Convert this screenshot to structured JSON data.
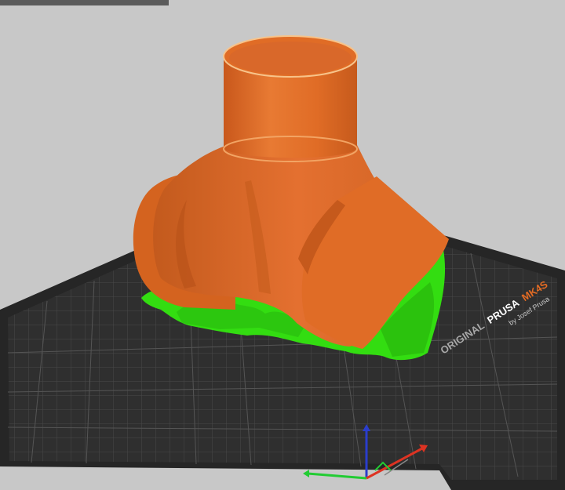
{
  "scene": {
    "bed_brand_prefix": "ORIGINAL",
    "bed_brand": "PRUSA",
    "bed_model": "MK4S",
    "bed_subtitle": "by Josef Prusa",
    "colors": {
      "background": "#c8c8c8",
      "bed": "#2b2b2b",
      "bed_grid": "#4a4a4a",
      "model": "#e06c26",
      "model_shadow": "#b8531a",
      "support": "#33dd11",
      "brand_accent": "#e36b24",
      "axis_x": "#22cc33",
      "axis_y": "#2a3dcc",
      "axis_z": "#dd3322"
    },
    "objects": [
      {
        "name": "Y-pipe adapter",
        "type": "model"
      },
      {
        "name": "support material",
        "type": "supports"
      }
    ],
    "toolbar_stub": "top-left toolbar edge",
    "axes": [
      "x-axis",
      "y-axis",
      "z-axis"
    ]
  }
}
